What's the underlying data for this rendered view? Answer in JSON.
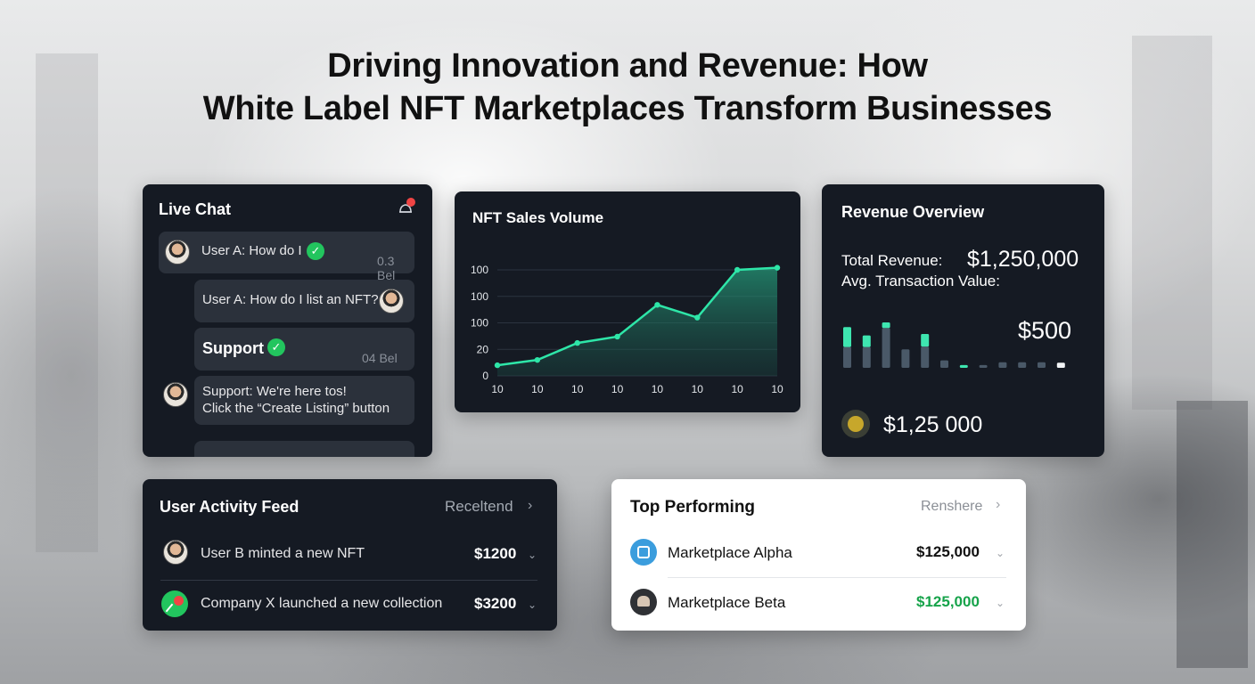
{
  "title": {
    "line1": "Driving Innovation and Revenue: How",
    "line2": "White Label NFT Marketplaces Transform Businesses"
  },
  "live_chat": {
    "title": "Live Chat",
    "messages": [
      {
        "text": "User A: How do I",
        "stamp": "0.3 Bel",
        "verified": true
      },
      {
        "text": "User A: How do I list an NFT?"
      },
      {
        "text": "Support",
        "stamp": "04 Bel",
        "verified": true
      },
      {
        "line1": "Support: We're here tos!",
        "line2": "Click the “Create Listing” button"
      }
    ]
  },
  "sales_chart": {
    "title": "NFT Sales Volume"
  },
  "chart_data": {
    "type": "area",
    "title": "NFT Sales Volume",
    "xlabel": "",
    "ylabel": "",
    "x_tick_labels": [
      "10",
      "10",
      "10",
      "10",
      "10",
      "10",
      "10",
      "10"
    ],
    "y_tick_labels": [
      "0",
      "20",
      "100",
      "100",
      "100"
    ],
    "series": [
      {
        "values": [
          0.1,
          0.15,
          0.31,
          0.37,
          0.67,
          0.55,
          1.0,
          1.02
        ]
      }
    ],
    "grid": true,
    "legend": "none"
  },
  "revenue": {
    "title": "Revenue Overview",
    "total_label": "Total Revenue:",
    "total_value": "$1,250,000",
    "avg_label": "Avg. Transaction Value:",
    "avg_value": "$500",
    "bottom_value": "$1,25 000",
    "bars": [
      {
        "dark": 0.45,
        "light": 0.43
      },
      {
        "dark": 0.45,
        "light": 0.25
      },
      {
        "dark": 0.86,
        "light": 0.12
      },
      {
        "dark": 0.4,
        "light": 0.0
      },
      {
        "dark": 0.46,
        "light": 0.27
      },
      {
        "dark": 0.16,
        "light": 0.0
      },
      {
        "dark": 0.0,
        "light": 0.06
      },
      {
        "dark": 0.06,
        "light": 0.0
      },
      {
        "dark": 0.12,
        "light": 0.0
      },
      {
        "dark": 0.12,
        "light": 0.0
      },
      {
        "dark": 0.12,
        "light": 0.0
      },
      {
        "dark": 0.0,
        "light": 0.11
      }
    ],
    "colors": {
      "dark": "#4a5968",
      "teal": "#3ee6b0",
      "white": "#f2f4f6"
    }
  },
  "activity": {
    "title": "User Activity Feed",
    "filter_label": "Receltend",
    "rows": [
      {
        "text": "User B minted a new NFT",
        "value": "$1200"
      },
      {
        "text": "Company X launched a new collection",
        "value": "$3200"
      }
    ]
  },
  "top_performing": {
    "title": "Top Performing",
    "filter_label": "Renshere",
    "rows": [
      {
        "name": "Marketplace Alpha",
        "value": "$125,000",
        "value_color": "#111111"
      },
      {
        "name": "Marketplace Beta",
        "value": "$125,000",
        "value_color": "#16a34a"
      }
    ]
  }
}
